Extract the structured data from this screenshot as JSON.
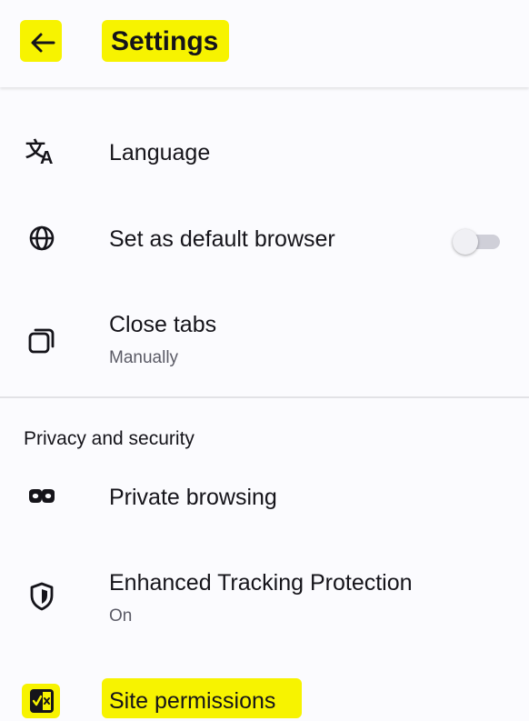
{
  "header": {
    "title": "Settings",
    "back_icon": "arrow-left-icon",
    "highlight_color": "#f7f300"
  },
  "general": {
    "items": [
      {
        "label": "Language",
        "icon": "translate-icon"
      },
      {
        "label": "Set as default browser",
        "icon": "globe-icon",
        "toggle_on": false
      },
      {
        "label": "Close tabs",
        "subtitle": "Manually",
        "icon": "tabs-icon"
      }
    ]
  },
  "privacy": {
    "section_title": "Privacy and security",
    "items": [
      {
        "label": "Private browsing",
        "icon": "mask-icon"
      },
      {
        "label": "Enhanced Tracking Protection",
        "subtitle": "On",
        "icon": "shield-icon"
      },
      {
        "label": "Site permissions",
        "icon": "site-permissions-icon"
      }
    ]
  }
}
